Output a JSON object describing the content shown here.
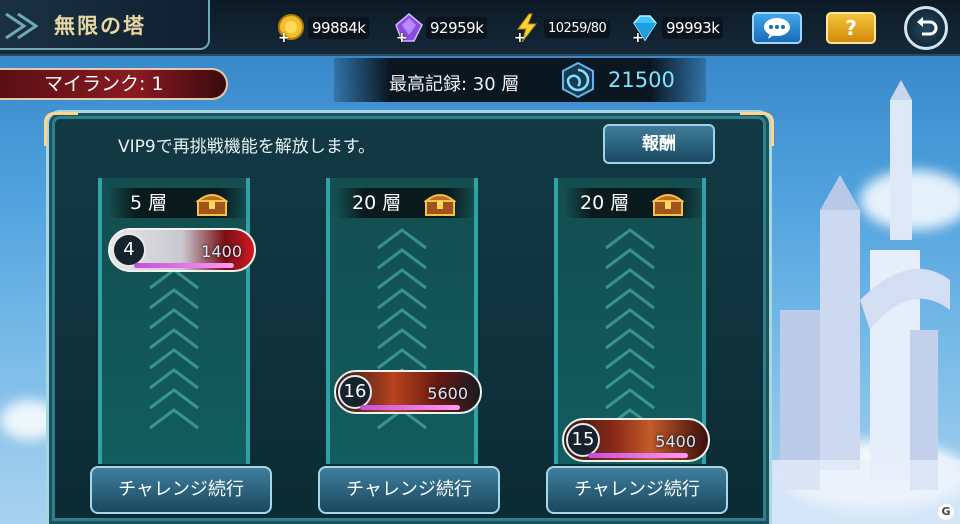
{
  "header": {
    "title": "無限の塔",
    "resources": [
      {
        "icon": "gold-coin-icon",
        "value": "99884k"
      },
      {
        "icon": "purple-gem-icon",
        "value": "92959k"
      },
      {
        "icon": "lightning-stamina-icon",
        "value": "10259/80"
      },
      {
        "icon": "diamond-icon",
        "value": "99993k"
      }
    ],
    "chat_icon": "chat-bubble-icon",
    "help_label": "?",
    "back_icon": "return-arrow-icon"
  },
  "rank": {
    "label": "マイランク: 1"
  },
  "record": {
    "label": "最高記録: 30 層",
    "value": "21500",
    "icon": "vortex-icon"
  },
  "panel": {
    "vip_text": "VIP9で再挑戦機能を解放します。",
    "reward_label": "報酬"
  },
  "columns": [
    {
      "floor": "5 層",
      "player_level": "4",
      "player_points": "1400",
      "challenge_label": "チャレンジ続行"
    },
    {
      "floor": "20 層",
      "player_level": "16",
      "player_points": "5600",
      "challenge_label": "チャレンジ続行"
    },
    {
      "floor": "20 層",
      "player_level": "15",
      "player_points": "5400",
      "challenge_label": "チャレンジ続行"
    }
  ],
  "colors": {
    "accent_gold": "#e9d7a2",
    "panel_border": "#a8d8de",
    "points_color": "#cfe9ff",
    "record_value": "#7fe3ff"
  }
}
